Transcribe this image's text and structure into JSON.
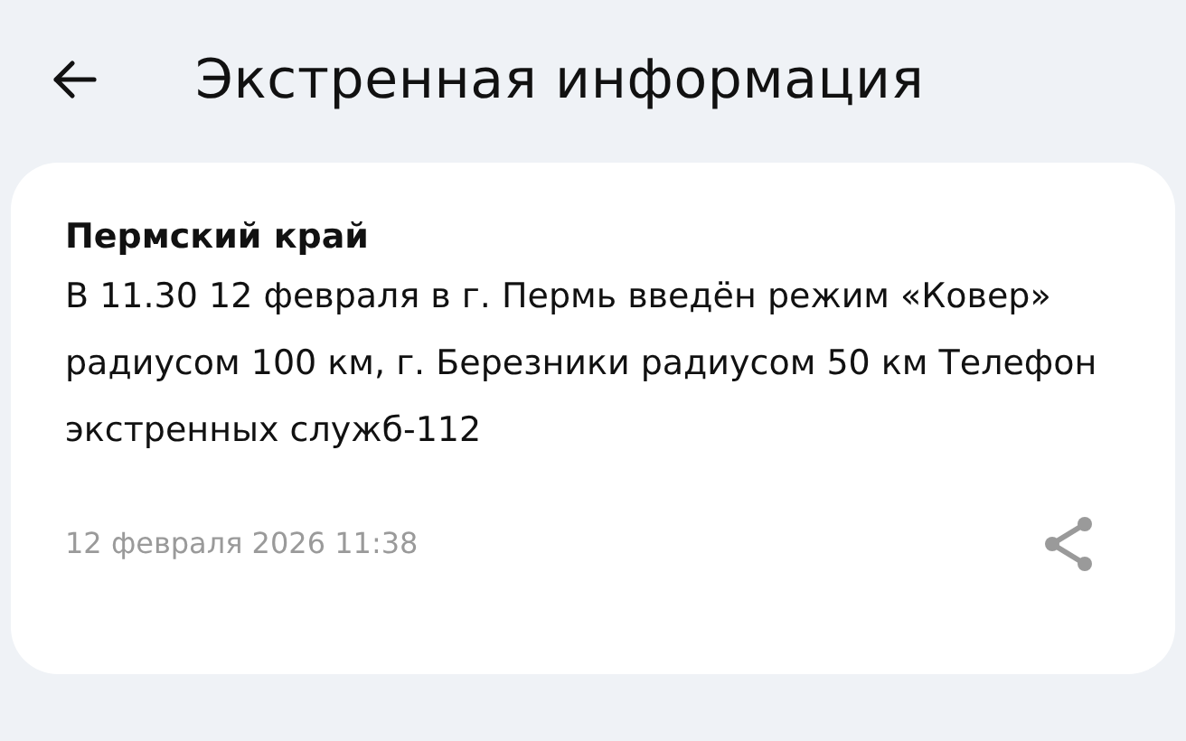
{
  "header": {
    "title": "Экстренная информация"
  },
  "message": {
    "region": "Пермский край",
    "text": "В 11.30 12 февраля в г. Пермь введён режим «Ковер» радиусом 100 км, г. Березники радиусом 50 км Телефон экстренных служб-112",
    "date": "12 февраля 2026 11:38"
  }
}
